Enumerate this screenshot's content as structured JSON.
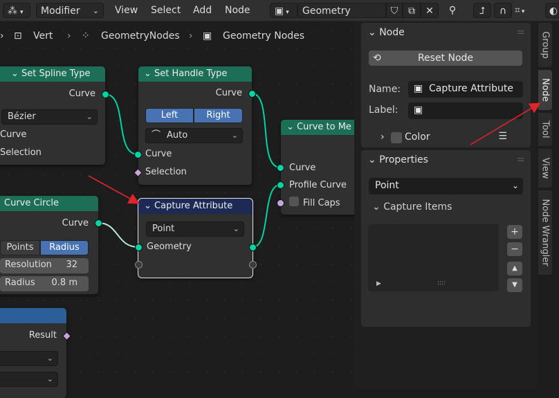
{
  "header": {
    "mode_menu": "Modifier",
    "menus": [
      "View",
      "Select",
      "Add",
      "Node"
    ],
    "tree_name": "Geometry Nodes"
  },
  "breadcrumb": [
    "Vert",
    "GeometryNodes",
    "Geometry Nodes"
  ],
  "nodes": {
    "set_spline_type": {
      "title": "Set Spline Type",
      "out": "Curve",
      "type_value": "Bézier",
      "in_curve": "Curve",
      "in_selection": "Selection"
    },
    "set_handle_type": {
      "title": "Set Handle Type",
      "out": "Curve",
      "left": "Left",
      "right": "Right",
      "mode": "Auto",
      "in_curve": "Curve",
      "in_selection": "Selection"
    },
    "curve_to_mesh": {
      "title": "Curve to Me",
      "in_curve": "Curve",
      "in_profile": "Profile Curve",
      "in_fill": "Fill Caps"
    },
    "curve_circle": {
      "title": "Curve Circle",
      "out": "Curve",
      "mode_points": "Points",
      "mode_radius": "Radius",
      "resolution_label": "Resolution",
      "resolution_value": "32",
      "radius_label": "Radius",
      "radius_value": "0.8 m"
    },
    "capture_attribute": {
      "title": "Capture Attribute",
      "domain": "Point",
      "in_geometry": "Geometry"
    },
    "blue_node": {
      "out": "Result"
    }
  },
  "sidebar": {
    "node_panel": {
      "title": "Node",
      "reset_button": "Reset Node",
      "name_label": "Name:",
      "name_value": "Capture Attribute",
      "label_label": "Label:",
      "label_value": "",
      "color_label": "Color"
    },
    "properties_panel": {
      "title": "Properties",
      "domain": "Point",
      "capture_items": "Capture Items"
    },
    "tabs": [
      "Group",
      "Node",
      "Tool",
      "View",
      "Node Wrangler"
    ],
    "active_tab": "Node"
  },
  "colors": {
    "accent": "#4772b3",
    "socket_geometry": "#00d6a3",
    "node_header_geometry": "#1c6e57",
    "annotation_arrow": "#e0242b"
  }
}
